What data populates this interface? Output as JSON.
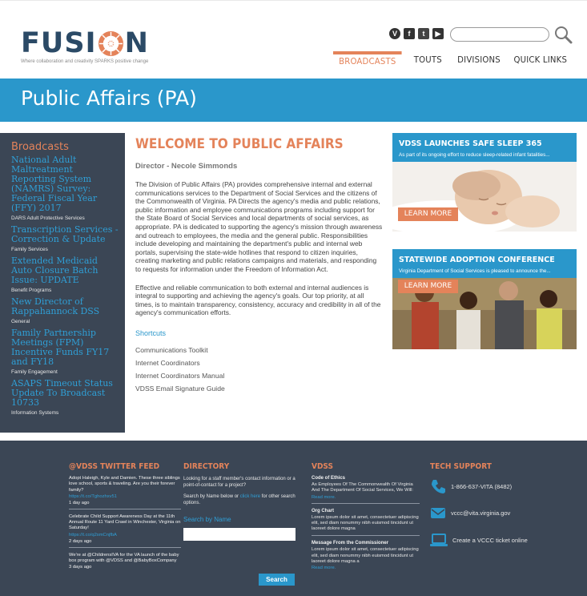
{
  "logo": {
    "word_left": "FUSI",
    "word_right": "N",
    "tagline": "Where collaboration and creativity SPARKS positive change"
  },
  "social": [
    "vimeo-icon",
    "facebook-icon",
    "twitter-icon",
    "youtube-icon"
  ],
  "search": {
    "placeholder": ""
  },
  "nav": {
    "broadcasts": "BROADCASTS",
    "touts": "TOUTS",
    "divisions": "DIVISIONS",
    "quick_links": "QUICK LINKS"
  },
  "banner": {
    "title": "Public Affairs (PA)"
  },
  "sidebar": {
    "title": "Broadcasts",
    "items": [
      {
        "title": "National Adult Maltreatment Reporting System (NAMRS) Survey: Federal Fiscal Year (FFY) 2017",
        "tag": "DARS Adult Protective Services"
      },
      {
        "title": "Transcription Services - Correction & Update",
        "tag": "Family Services"
      },
      {
        "title": "Extended Medicaid Auto Closure Batch Issue: UPDATE",
        "tag": "Benefit Programs"
      },
      {
        "title": "New Director of Rappahannock DSS",
        "tag": "General"
      },
      {
        "title": "Family Partnership Meetings (FPM) Incentive Funds FY17 and FY18",
        "tag": "Family Engagement"
      },
      {
        "title": "ASAPS Timeout Status Update To Broadcast 10733",
        "tag": "Information Systems"
      }
    ]
  },
  "main": {
    "title": "WELCOME TO PUBLIC AFFAIRS",
    "director": "Director - Necole Simmonds",
    "para1": "The Division of Public Affairs (PA) provides comprehensive internal and external communications services to the Department of Social Services and the citizens of the Commonwealth of Virginia. PA Directs the agency's media and public relations, public information and employee communications programs including support for the State Board of Social Services and local departments of social services, as appropriate. PA is dedicated to supporting the agency's mission through awareness and outreach to employees, the media and the general public. Responsibilities include developing and maintaining the department's public and internal web portals, supervising the state-wide hotlines that respond to citizen inquiries, creating marketing and public relations campaigns and materials, and responding to requests for information under the Freedom of Information Act.",
    "para2": "Effective and reliable communication to both external and internal audiences is integral to supporting and achieving the agency's goals. Our top priority, at all times, is to maintain transparency, consistency, accuracy and credibility in all of the agency's communication efforts.",
    "shortcuts_title": "Shortcuts",
    "shortcuts": [
      "Communications Toolkit",
      "Internet Coordinators",
      "Internet Coordinators Manual",
      "VDSS Email Signature Guide"
    ]
  },
  "promos": [
    {
      "title": "VDSS LAUNCHES SAFE SLEEP 365",
      "subtitle": "As part of its ongoing effort to reduce sleep-related infant fatalities...",
      "button": "LEARN MORE"
    },
    {
      "title": "STATEWIDE ADOPTION CONFERENCE",
      "subtitle": "Virginia Department of Social Services is pleased to announce the...",
      "button": "LEARN MORE"
    }
  ],
  "footer": {
    "twitter": {
      "title": "@VDSS TWITTER FEED",
      "tweets": [
        {
          "text": "Adopt Haleigh, Kyle and Damien. These three siblings love school, sports & traveling. Are you their forever family?",
          "link": "https://t.co/Tghozhxv51",
          "time": "1 day ago"
        },
        {
          "text": "Celebrate Child Support Awareness Day at the 11th Annual Route 11 Yard Crawl in Winchester, Virginia on Saturday!",
          "link": "https://t.co/q2smCnjfbA",
          "time": "2 days ago"
        },
        {
          "text": "We're at @ChildrensIVA for the VA launch of the baby box program with @VDSS and @BabyBoxCompany",
          "link": "",
          "time": "3 days ago"
        }
      ]
    },
    "directory": {
      "title": "DIRECTORY",
      "text1": "Looking for a staff member's contact information or a point-of-contact for a project?",
      "text2_pre": "Search by Name below or ",
      "text2_link": "click here",
      "text2_post": " for other search options.",
      "label": "Search by Name",
      "button": "Search"
    },
    "vdss": {
      "title": "VDSS",
      "items": [
        {
          "title": "Code of Ethics",
          "text": "As Employees Of The Commonwealth Of Virginia And The Department Of Social Services, We Will:",
          "more": "Read more."
        },
        {
          "title": "Org Chart",
          "text": "Lorem ipsum dolor sit amet, consectetuer adipiscing elit, sed diam nonummy nibh euismod tincidunt ut laoreet dolore magna",
          "more": ""
        },
        {
          "title": "Message From the Commissioner",
          "text": "Lorem ipsum dolor sit amet, consectetuer adipiscing elit, sed diam nonummy nibh euismod tincidunt ut laoreet dolore magna a",
          "more": "Read more."
        }
      ]
    },
    "tech": {
      "title": "TECH SUPPORT",
      "phone": "1-866-637-VITA (8482)",
      "email": "vccc@vita.virginia.gov",
      "ticket": "Create a VCCC ticket online"
    }
  },
  "colors": {
    "accent": "#e4835a",
    "blue": "#2a97cb",
    "dark": "#3b4655",
    "navy": "#2b4a66"
  }
}
